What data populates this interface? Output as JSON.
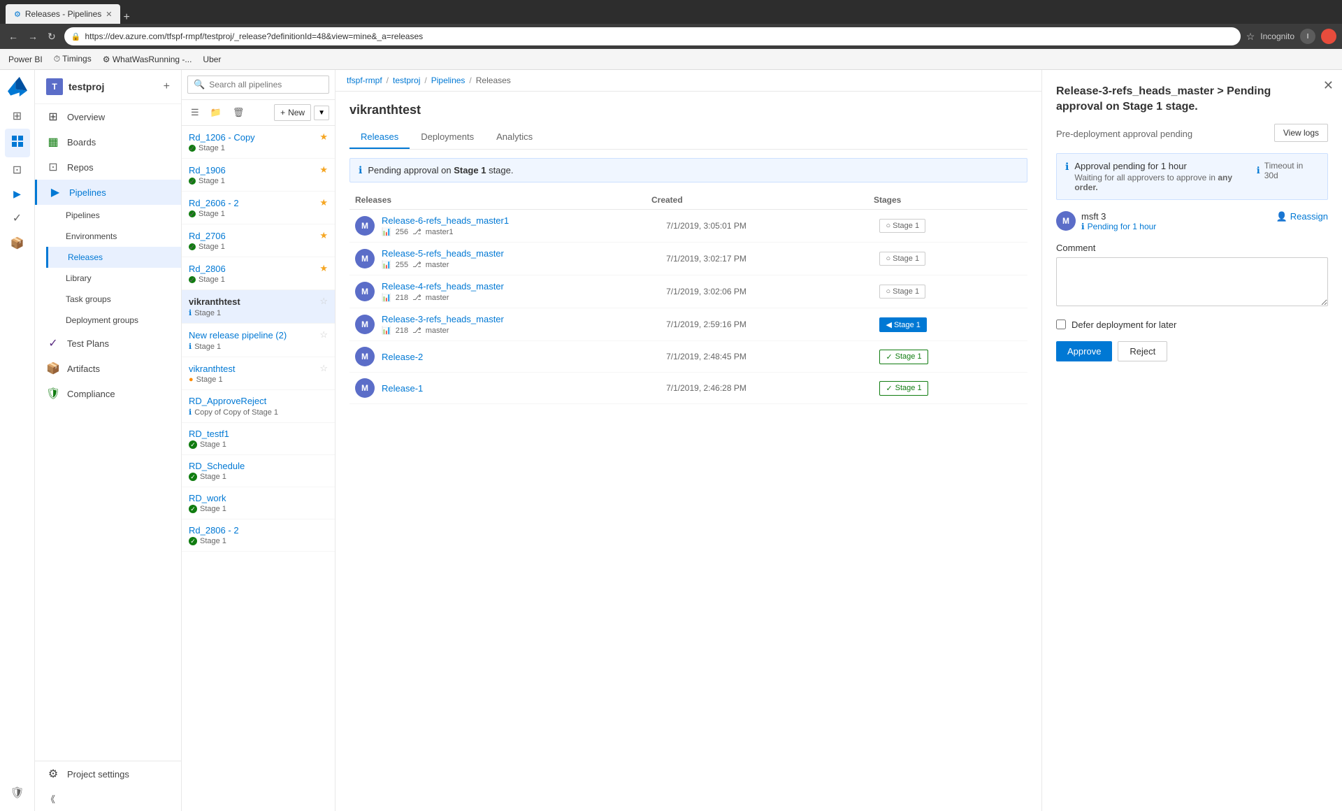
{
  "browser": {
    "tab_title": "Releases - Pipelines",
    "url": "https://dev.azure.com/tfspf-rmpf/testproj/_release?definitionId=48&view=mine&_a=releases",
    "incognito_label": "Incognito",
    "bookmarks": [
      "Power BI",
      "Timings",
      "WhatWasRunning -...",
      "Uber"
    ]
  },
  "app": {
    "name": "Azure DevOps",
    "project": "testproj"
  },
  "breadcrumb": {
    "items": [
      "tfspf-rmpf",
      "testproj",
      "Pipelines",
      "Releases"
    ]
  },
  "sidebar": {
    "project_avatar": "T",
    "project_name": "testproj",
    "items": [
      {
        "id": "overview",
        "label": "Overview",
        "icon": "⊞"
      },
      {
        "id": "boards",
        "label": "Boards",
        "icon": "▦"
      },
      {
        "id": "repos",
        "label": "Repos",
        "icon": "⊡"
      },
      {
        "id": "pipelines",
        "label": "Pipelines",
        "icon": "▶"
      },
      {
        "id": "test-plans",
        "label": "Test Plans",
        "icon": "✓"
      },
      {
        "id": "artifacts",
        "label": "Artifacts",
        "icon": "📦"
      },
      {
        "id": "compliance",
        "label": "Compliance",
        "icon": "🛡"
      }
    ],
    "pipelines_sub": [
      {
        "id": "pipelines",
        "label": "Pipelines"
      },
      {
        "id": "environments",
        "label": "Environments"
      },
      {
        "id": "releases",
        "label": "Releases"
      },
      {
        "id": "library",
        "label": "Library"
      },
      {
        "id": "task-groups",
        "label": "Task groups"
      },
      {
        "id": "deployment-groups",
        "label": "Deployment groups"
      }
    ],
    "project_settings": "Project settings"
  },
  "pipeline_list": {
    "search_placeholder": "Search all pipelines",
    "new_button": "New",
    "items": [
      {
        "id": 1,
        "name": "Rd_1206 - Copy",
        "stage": "Stage 1",
        "stage_status": "green",
        "starred": true
      },
      {
        "id": 2,
        "name": "Rd_1906",
        "stage": "Stage 1",
        "stage_status": "green",
        "starred": true
      },
      {
        "id": 3,
        "name": "Rd_2606 - 2",
        "stage": "Stage 1",
        "stage_status": "green",
        "starred": true
      },
      {
        "id": 4,
        "name": "Rd_2706",
        "stage": "Stage 1",
        "stage_status": "green",
        "starred": true
      },
      {
        "id": 5,
        "name": "Rd_2806",
        "stage": "Stage 1",
        "stage_status": "green",
        "starred": true
      },
      {
        "id": 6,
        "name": "vikranthtest",
        "stage": "Stage 1",
        "stage_status": "blue",
        "starred": false,
        "active": true
      },
      {
        "id": 7,
        "name": "New release pipeline (2)",
        "stage": "Stage 1",
        "stage_status": "blue",
        "starred": false
      },
      {
        "id": 8,
        "name": "vikranthtest",
        "stage": "Stage 1",
        "stage_status": "orange",
        "starred": false
      },
      {
        "id": 9,
        "name": "RD_ApproveReject",
        "stage": "Copy of Copy of Stage 1",
        "stage_status": "blue",
        "starred": false
      },
      {
        "id": 10,
        "name": "RD_testf1",
        "stage": "Stage 1",
        "stage_status": "green",
        "starred": false
      },
      {
        "id": 11,
        "name": "RD_Schedule",
        "stage": "Stage 1",
        "stage_status": "green",
        "starred": false
      },
      {
        "id": 12,
        "name": "RD_work",
        "stage": "Stage 1",
        "stage_status": "green",
        "starred": false
      },
      {
        "id": 13,
        "name": "Rd_2806 - 2",
        "stage": "Stage 1",
        "stage_status": "green",
        "starred": false
      }
    ]
  },
  "release_definition": {
    "name": "vikranthtest",
    "tabs": [
      {
        "id": "releases",
        "label": "Releases",
        "active": true
      },
      {
        "id": "deployments",
        "label": "Deployments"
      },
      {
        "id": "analytics",
        "label": "Analytics"
      }
    ],
    "pending_banner": "Pending approval on Stage 1 stage.",
    "table_headers": {
      "releases": "Releases",
      "created": "Created",
      "stages": "Stages"
    },
    "releases": [
      {
        "id": 1,
        "avatar": "M",
        "name": "Release-6-refs_heads_master1",
        "build": "256",
        "branch": "master1",
        "created": "7/1/2019, 3:05:01 PM",
        "stage": "Stage 1",
        "stage_type": "default"
      },
      {
        "id": 2,
        "avatar": "M",
        "name": "Release-5-refs_heads_master",
        "build": "255",
        "branch": "master",
        "created": "7/1/2019, 3:02:17 PM",
        "stage": "Stage 1",
        "stage_type": "default"
      },
      {
        "id": 3,
        "avatar": "M",
        "name": "Release-4-refs_heads_master",
        "build": "218",
        "branch": "master",
        "created": "7/1/2019, 3:02:06 PM",
        "stage": "Stage 1",
        "stage_type": "default"
      },
      {
        "id": 4,
        "avatar": "M",
        "name": "Release-3-refs_heads_master",
        "build": "218",
        "branch": "master",
        "created": "7/1/2019, 2:59:16 PM",
        "stage": "Stage 1",
        "stage_type": "pending"
      },
      {
        "id": 5,
        "avatar": "M",
        "name": "Release-2",
        "build": null,
        "branch": null,
        "created": "7/1/2019, 2:48:45 PM",
        "stage": "Stage 1",
        "stage_type": "success"
      },
      {
        "id": 6,
        "avatar": "M",
        "name": "Release-1",
        "build": null,
        "branch": null,
        "created": "7/1/2019, 2:46:28 PM",
        "stage": "Stage 1",
        "stage_type": "success"
      }
    ]
  },
  "right_panel": {
    "title": "Release-3-refs_heads_master > Pending approval on Stage 1 stage.",
    "subtitle": "Pre-deployment approval pending",
    "view_logs_label": "View logs",
    "approval_info": {
      "pending_text": "Approval pending for 1 hour",
      "sub_text_prefix": "Waiting for all approvers to approve in",
      "sub_text_highlight": "any order.",
      "timeout_label": "Timeout in 30d"
    },
    "approver": {
      "avatar": "M",
      "name": "msft 3",
      "status": "Pending for 1 hour"
    },
    "reassign_label": "Reassign",
    "comment_label": "Comment",
    "comment_placeholder": "",
    "defer_label": "Defer deployment for later",
    "approve_label": "Approve",
    "reject_label": "Reject"
  }
}
